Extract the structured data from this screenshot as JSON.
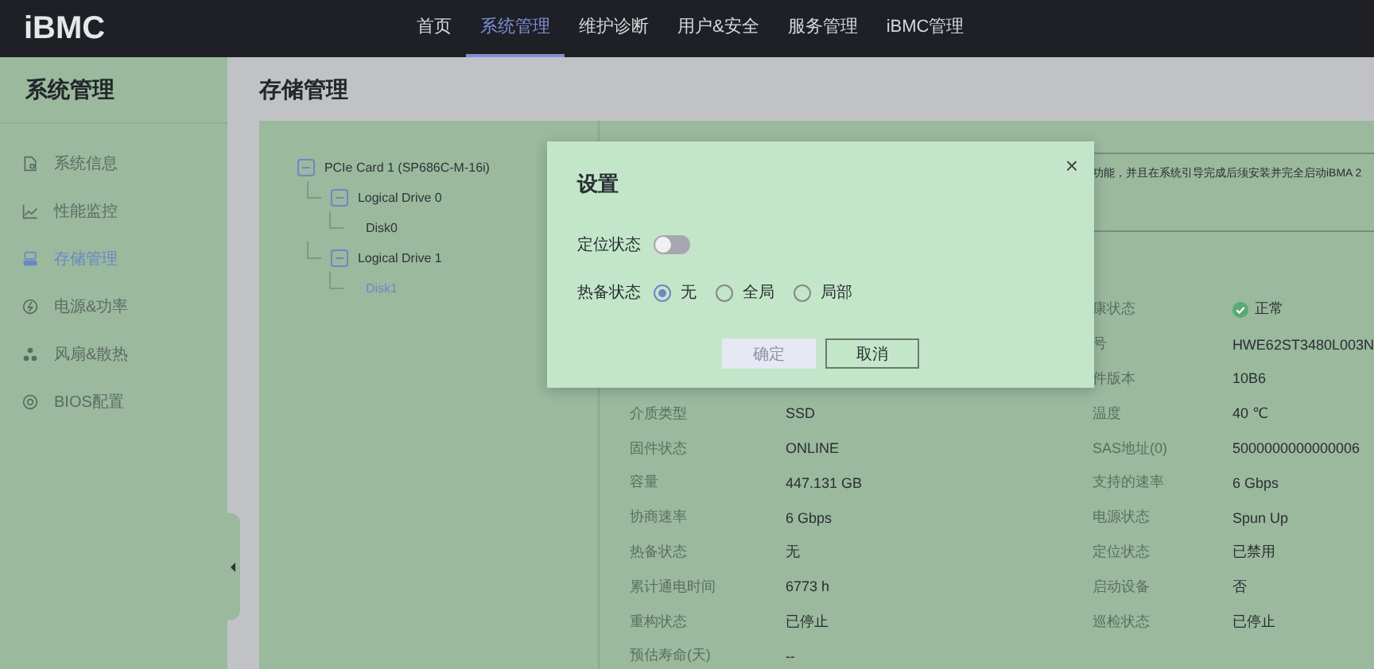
{
  "header": {
    "logo": "iBMC",
    "nav": [
      {
        "label": "首页",
        "selected": false
      },
      {
        "label": "系统管理",
        "selected": true
      },
      {
        "label": "维护诊断",
        "selected": false
      },
      {
        "label": "用户&安全",
        "selected": false
      },
      {
        "label": "服务管理",
        "selected": false
      },
      {
        "label": "iBMC管理",
        "selected": false
      }
    ]
  },
  "sidebar": {
    "title": "系统管理",
    "items": [
      {
        "label": "系统信息",
        "selected": false
      },
      {
        "label": "性能监控",
        "selected": false
      },
      {
        "label": "存储管理",
        "selected": true
      },
      {
        "label": "电源&功率",
        "selected": false
      },
      {
        "label": "风扇&散热",
        "selected": false
      },
      {
        "label": "BIOS配置",
        "selected": false
      }
    ]
  },
  "page": {
    "title": "存储管理"
  },
  "tree": [
    {
      "label": "PCIe Card 1 (SP686C-M-16i)",
      "expanded": true,
      "selected": false,
      "children": [
        {
          "label": "Logical Drive 0",
          "expanded": true,
          "selected": false,
          "children": [
            {
              "label": "Disk0",
              "selected": false
            }
          ]
        },
        {
          "label": "Logical Drive 1",
          "expanded": true,
          "selected": false,
          "children": [
            {
              "label": "Disk1",
              "selected": true
            }
          ]
        }
      ]
    }
  ],
  "notice": "功能，并且在系统引导完成后须安装并完全启动iBMA 2",
  "details": [
    {
      "right": {
        "label": "康状态",
        "value": "正常"
      }
    },
    {
      "right": {
        "label": "号",
        "value": "HWE62ST3480L003N"
      }
    },
    {
      "right": {
        "label": "件版本",
        "value": "10B6"
      }
    },
    {
      "left": {
        "label": "介质类型",
        "value": "SSD"
      },
      "right": {
        "label": "温度",
        "value": "40 ℃"
      }
    },
    {
      "left": {
        "label": "固件状态",
        "value": "ONLINE"
      },
      "right": {
        "label": "SAS地址(0)",
        "value": "5000000000000006"
      }
    },
    {
      "left": {
        "label": "容量",
        "value": "447.131 GB"
      },
      "right": {
        "label": "支持的速率",
        "value": "6 Gbps"
      }
    },
    {
      "left": {
        "label": "协商速率",
        "value": "6 Gbps"
      },
      "right": {
        "label": "电源状态",
        "value": "Spun Up"
      }
    },
    {
      "left": {
        "label": "热备状态",
        "value": "无"
      },
      "right": {
        "label": "定位状态",
        "value": "已禁用"
      }
    },
    {
      "left": {
        "label": "累计通电时间",
        "value": "6773 h"
      },
      "right": {
        "label": "启动设备",
        "value": "否"
      }
    },
    {
      "left": {
        "label": "重构状态",
        "value": "已停止"
      },
      "right": {
        "label": "巡检状态",
        "value": "已停止"
      }
    },
    {
      "left": {
        "label": "预估寿命(天)",
        "value": "--"
      }
    }
  ],
  "dialog": {
    "title": "设置",
    "close": "×",
    "locate": {
      "label": "定位状态",
      "on": false
    },
    "hotspare": {
      "label": "热备状态",
      "options": [
        {
          "label": "无",
          "selected": true
        },
        {
          "label": "全局",
          "selected": false
        },
        {
          "label": "局部",
          "selected": false
        }
      ]
    },
    "buttons": [
      {
        "label": "确定",
        "disabled": true
      },
      {
        "label": "取消",
        "disabled": false
      }
    ]
  }
}
